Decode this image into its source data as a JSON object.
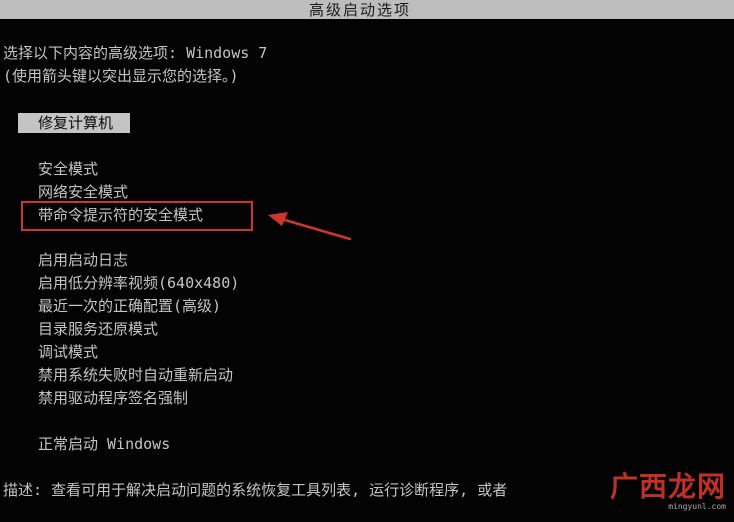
{
  "title": "高级启动选项",
  "prompt_line1": "选择以下内容的高级选项: Windows 7",
  "prompt_line2": "(使用箭头键以突出显示您的选择。)",
  "selected_option": "修复计算机",
  "menu_group1": [
    {
      "label": "安全模式"
    },
    {
      "label": "网络安全模式"
    },
    {
      "label": "带命令提示符的安全模式"
    }
  ],
  "menu_group2": [
    {
      "label": "启用启动日志"
    },
    {
      "label": "启用低分辨率视频(640x480)"
    },
    {
      "label": "最近一次的正确配置(高级)"
    },
    {
      "label": "目录服务还原模式"
    },
    {
      "label": "调试模式"
    },
    {
      "label": "禁用系统失败时自动重新启动"
    },
    {
      "label": "禁用驱动程序签名强制"
    }
  ],
  "menu_group3": [
    {
      "label": "正常启动 Windows"
    }
  ],
  "description": "描述: 查看可用于解决启动问题的系统恢复工具列表, 运行诊断程序, 或者",
  "watermark": {
    "text": "广西龙网",
    "url": "mingyunl.com"
  },
  "colors": {
    "background": "#030303",
    "text": "#c4c4c4",
    "title_bar": "#bdbdbd",
    "annotation": "#d0352b"
  }
}
